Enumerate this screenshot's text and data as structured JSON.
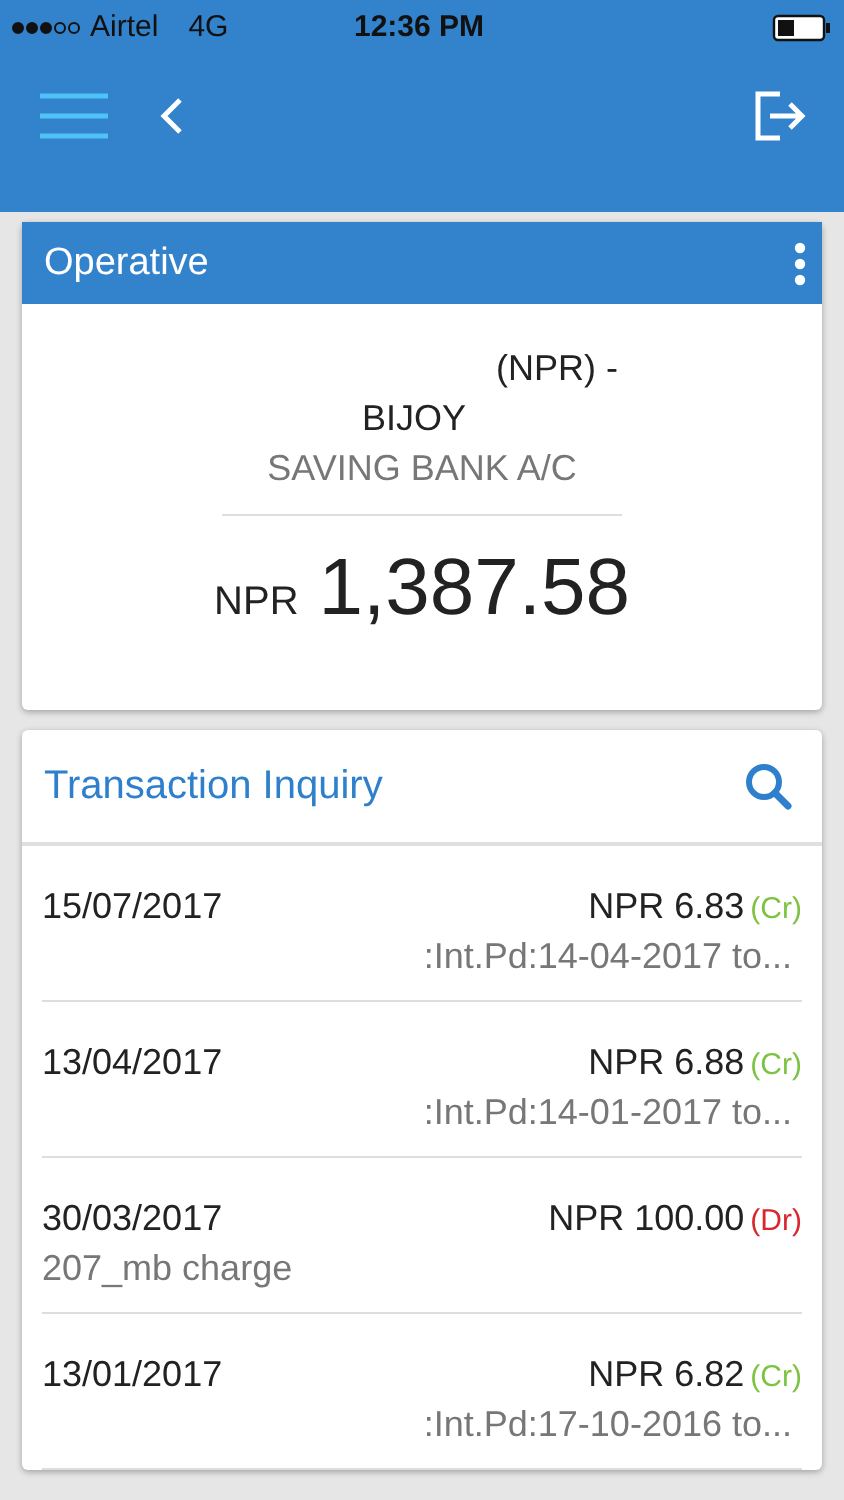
{
  "status_bar": {
    "carrier": "Airtel",
    "network": "4G",
    "time": "12:36 PM"
  },
  "account": {
    "title": "Operative",
    "currency_line": "(NPR) -",
    "name": "BIJOY",
    "type": "SAVING BANK A/C",
    "currency": "NPR",
    "balance": "1,387.58"
  },
  "transactions": {
    "title": "Transaction Inquiry",
    "items": [
      {
        "date": "15/07/2017",
        "amount": "NPR 6.83",
        "kind": "credit",
        "tag": "(Cr)",
        "description": ":Int.Pd:14-04-2017 to..."
      },
      {
        "date": "13/04/2017",
        "amount": "NPR 6.88",
        "kind": "credit",
        "tag": "(Cr)",
        "description": ":Int.Pd:14-01-2017 to..."
      },
      {
        "date": "30/03/2017",
        "amount": "NPR 100.00",
        "kind": "debit",
        "tag": "(Dr)",
        "description": "207_mb charge"
      },
      {
        "date": "13/01/2017",
        "amount": "NPR 6.82",
        "kind": "credit",
        "tag": "(Cr)",
        "description": ":Int.Pd:17-10-2016 to..."
      }
    ]
  }
}
